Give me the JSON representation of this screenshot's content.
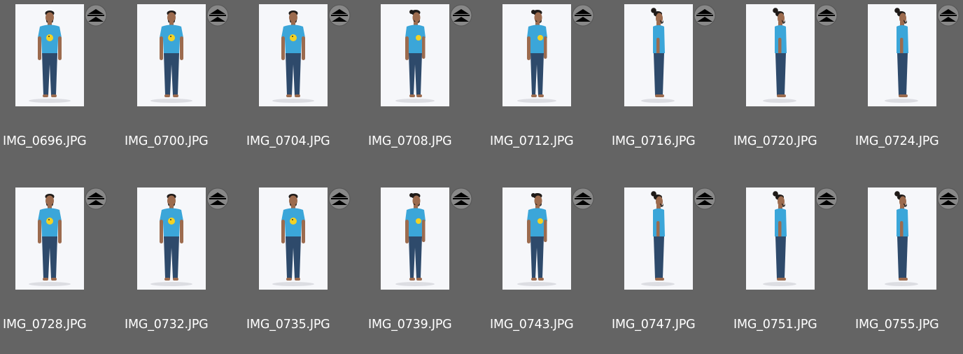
{
  "browser": {
    "items": [
      {
        "filename": "IMG_0696.JPG",
        "pose": "front"
      },
      {
        "filename": "IMG_0700.JPG",
        "pose": "front"
      },
      {
        "filename": "IMG_0704.JPG",
        "pose": "front"
      },
      {
        "filename": "IMG_0708.JPG",
        "pose": "three-quarter"
      },
      {
        "filename": "IMG_0712.JPG",
        "pose": "three-quarter"
      },
      {
        "filename": "IMG_0716.JPG",
        "pose": "side"
      },
      {
        "filename": "IMG_0720.JPG",
        "pose": "side"
      },
      {
        "filename": "IMG_0724.JPG",
        "pose": "side"
      },
      {
        "filename": "IMG_0728.JPG",
        "pose": "front"
      },
      {
        "filename": "IMG_0732.JPG",
        "pose": "front"
      },
      {
        "filename": "IMG_0735.JPG",
        "pose": "front"
      },
      {
        "filename": "IMG_0739.JPG",
        "pose": "three-quarter"
      },
      {
        "filename": "IMG_0743.JPG",
        "pose": "three-quarter"
      },
      {
        "filename": "IMG_0747.JPG",
        "pose": "side"
      },
      {
        "filename": "IMG_0751.JPG",
        "pose": "side"
      },
      {
        "filename": "IMG_0755.JPG",
        "pose": "side"
      }
    ]
  },
  "colors": {
    "background": "#646464",
    "photo_backdrop": "#f6f7fa",
    "shirt": "#3ba6d9",
    "jeans": "#2e4a6b",
    "skin": "#9c6b4e",
    "hair": "#1e1a18",
    "badge_fill": "#888888",
    "badge_icon": "#000000",
    "label_text": "#ffffff"
  },
  "icons": {
    "stack_badge": "collapse-stack-icon"
  }
}
